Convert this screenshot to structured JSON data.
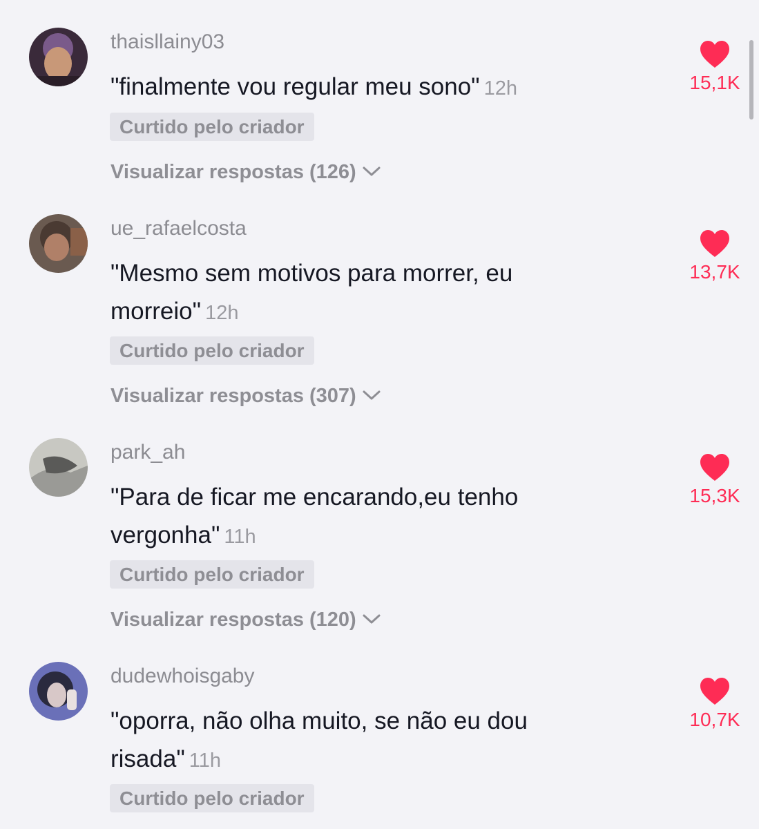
{
  "comments": [
    {
      "username": "thaisllainy03",
      "text": "\"finalmente vou regular meu sono\"",
      "time": "12h",
      "badge": "Curtido pelo criador",
      "replies": "Visualizar respostas (126)",
      "likes": "15,1K",
      "avatar_colors": [
        "#3a2a3a",
        "#7a5a8a",
        "#c89878"
      ]
    },
    {
      "username": "ue_rafaelcosta",
      "text": "\"Mesmo sem motivos para morrer, eu morreio\"",
      "time": "12h",
      "badge": "Curtido pelo criador",
      "replies": "Visualizar respostas (307)",
      "likes": "13,7K",
      "avatar_colors": [
        "#4a3a32",
        "#8a6048",
        "#b08068"
      ]
    },
    {
      "username": "park_ah",
      "text": "\"Para de ficar me encarando,eu tenho vergonha\"",
      "time": "11h",
      "badge": "Curtido pelo criador",
      "replies": "Visualizar respostas (120)",
      "likes": "15,3K",
      "avatar_colors": [
        "#9a9a96",
        "#c8c8c2",
        "#5a5a58"
      ]
    },
    {
      "username": "dudewhoisgaby",
      "text": "\"oporra, não olha muito, se não eu dou risada\"",
      "time": "11h",
      "badge": "Curtido pelo criador",
      "replies": "",
      "likes": "10,7K",
      "avatar_colors": [
        "#2a2a3e",
        "#6a70b8",
        "#d8c8c8"
      ]
    }
  ],
  "icons": {
    "heart": "heart-icon",
    "chevron": "chevron-down-icon"
  },
  "colors": {
    "like": "#fe2c55",
    "background": "#f3f3f7",
    "text": "#161823",
    "muted": "#8e8e94"
  }
}
